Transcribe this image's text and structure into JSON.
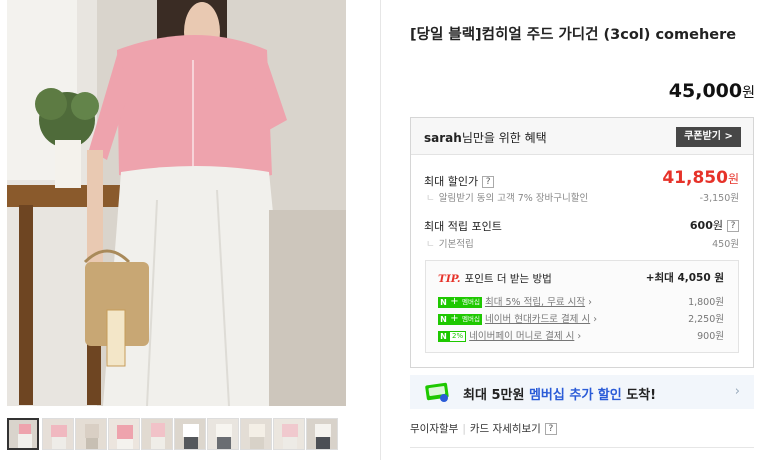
{
  "product": {
    "title": "[당일 블랙]컴히얼 주드 가디건 (3col) comehere",
    "price": "45,000",
    "price_unit": "원"
  },
  "benefit": {
    "user": "sarah",
    "header_suffix": "님만을 위한 혜택",
    "coupon_button": "쿠폰받기 >",
    "max_discount_label": "최대 할인가",
    "max_discount_price": "41,850",
    "max_discount_unit": "원",
    "discount_note": "알림받기 동의 고객 7% 장바구니할인",
    "discount_note_value": "-3,150원",
    "max_points_label": "최대 적립 포인트",
    "max_points_value": "600",
    "max_points_unit": "원",
    "basic_points_label": "기본적립",
    "basic_points_value": "450원",
    "help": "?"
  },
  "tip": {
    "badge": "TIP.",
    "title": "포인트 더 받는 방법",
    "total": "+최대 4,050 원",
    "rows": [
      {
        "text": "최대 5% 적립, 무료 시작",
        "value": "1,800원",
        "badge": "멤버십"
      },
      {
        "text": "네이버 현대카드로 결제 시",
        "value": "2,250원",
        "badge": "멤버십"
      },
      {
        "text": "네이버페이 머니로 결제 시",
        "value": "900원",
        "badge": "2%"
      }
    ]
  },
  "banner": {
    "prefix": "최대 5만원",
    "highlight": "멤버십 추가 할인",
    "suffix": "도착!",
    "icon_text": "멤버십"
  },
  "links": {
    "installment": "무이자할부",
    "card_detail": "카드 자세히보기",
    "help": "?"
  },
  "colors": {
    "sale_red": "#e63229",
    "naver_green": "#1ec800",
    "membership_blue": "#2a5bd7"
  }
}
